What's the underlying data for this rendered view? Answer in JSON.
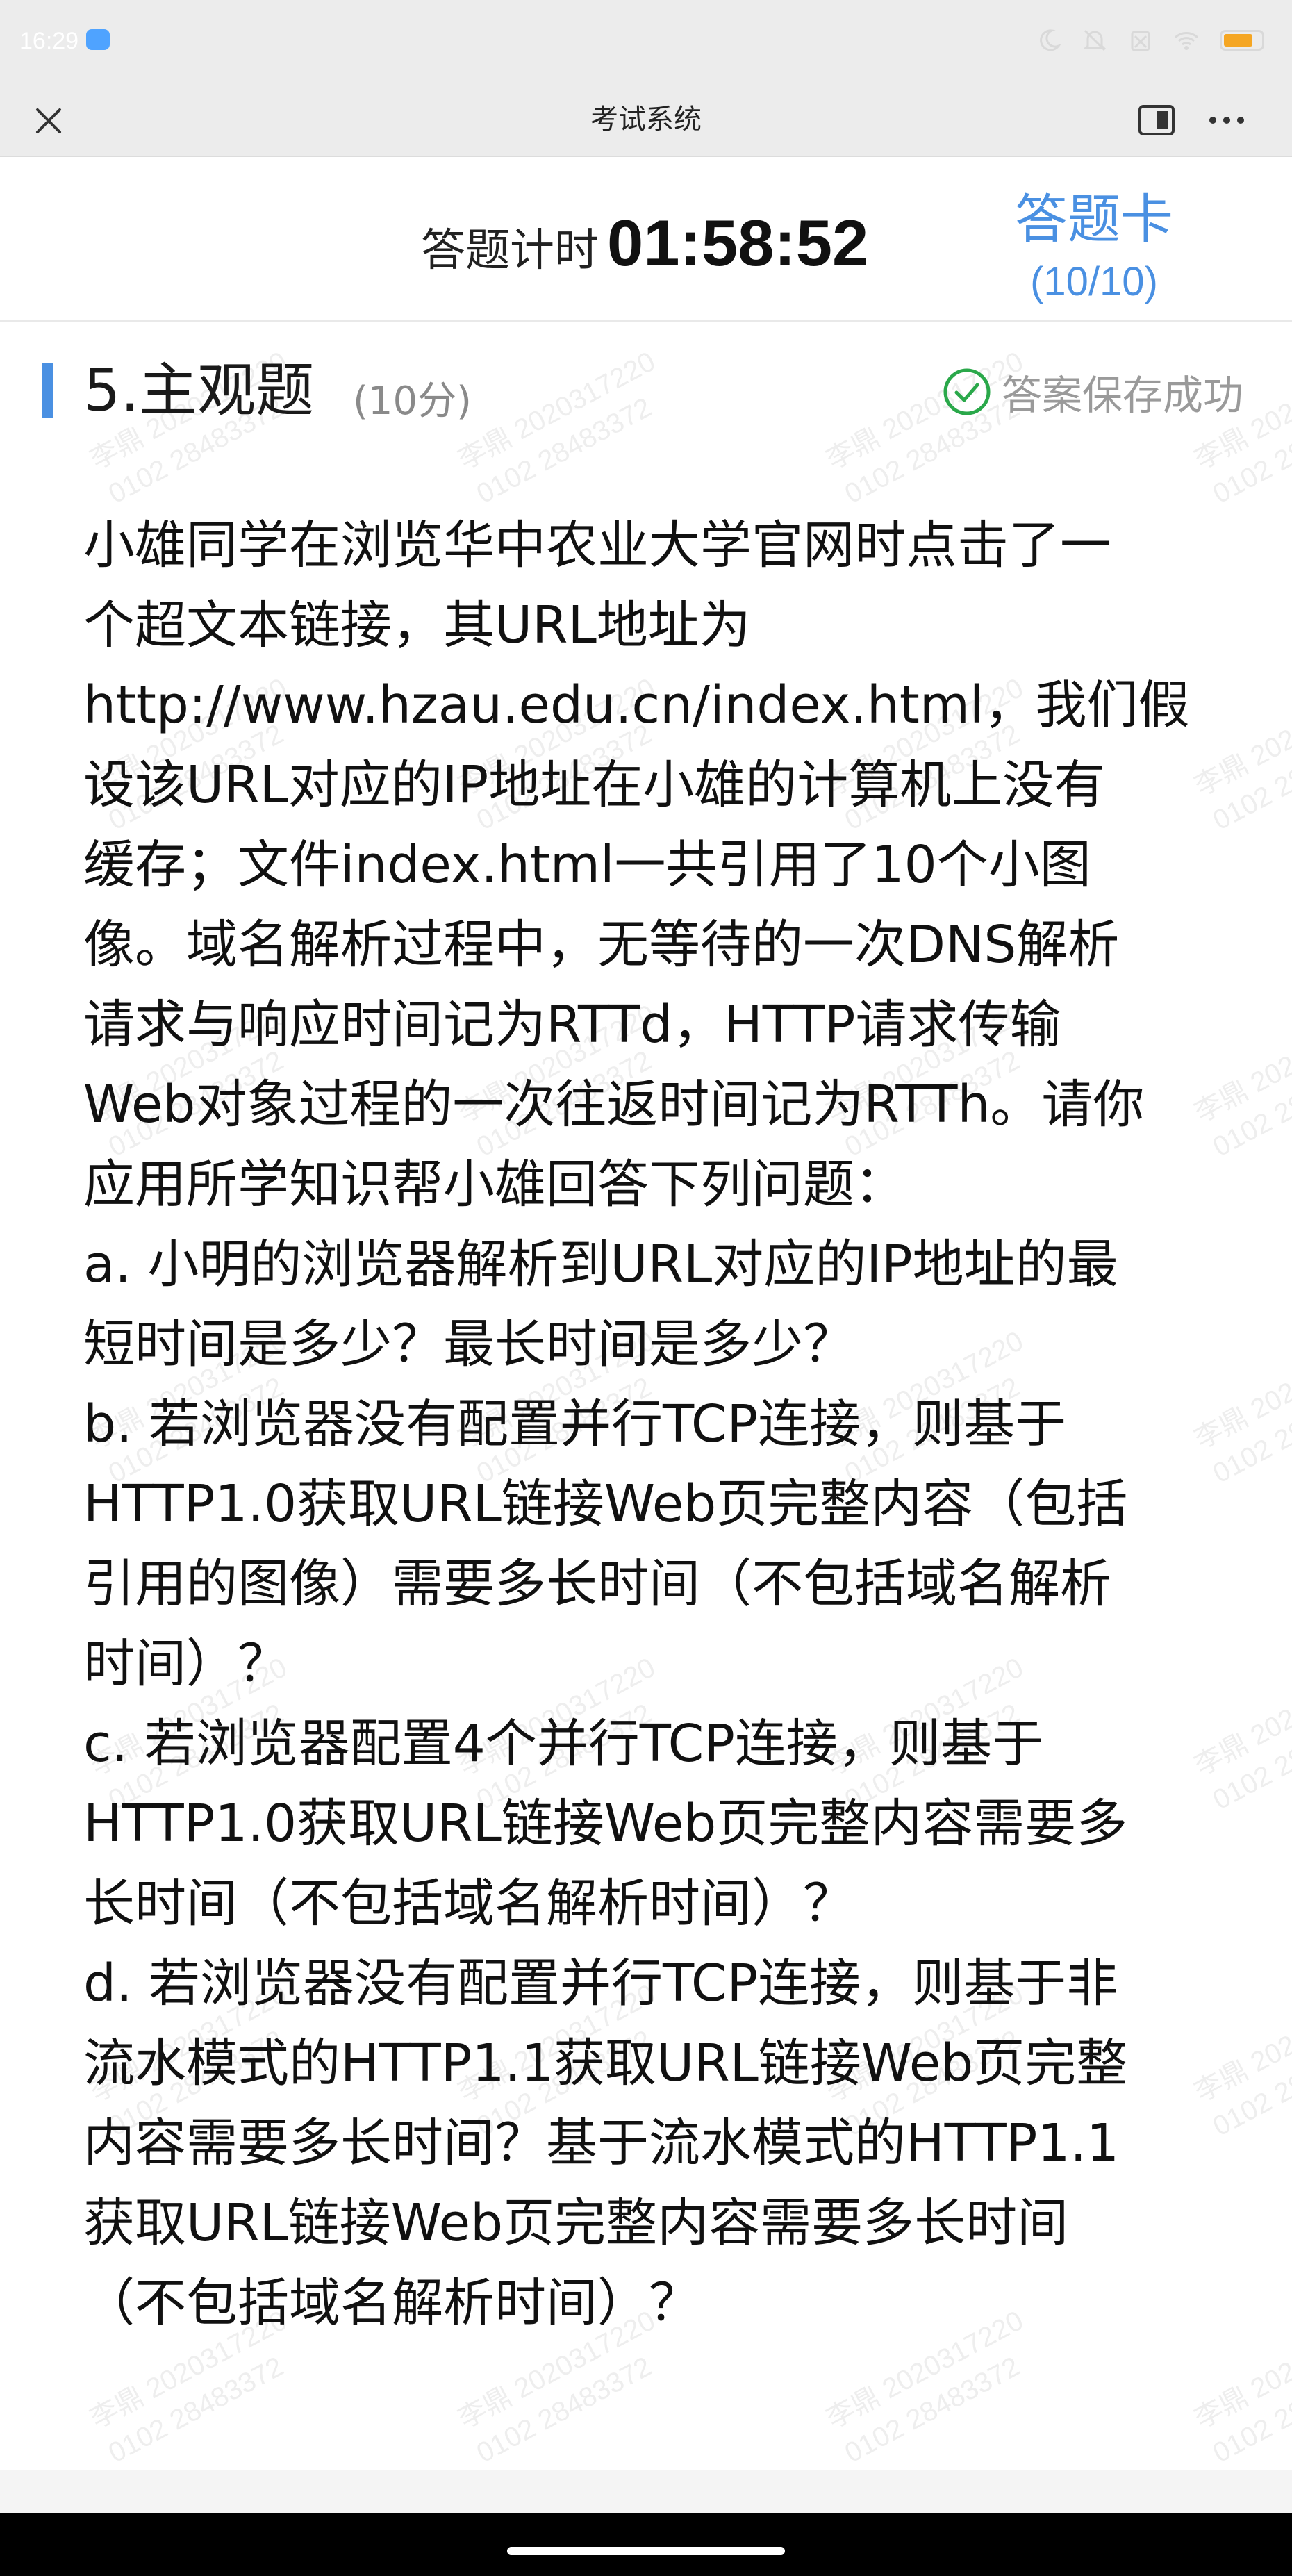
{
  "status_bar": {
    "time": "16:29",
    "icons": [
      "weather-icon",
      "moon-icon",
      "mute-icon",
      "no-sim-icon",
      "wifi-icon",
      "battery-icon"
    ],
    "battery_color": "#f5a623"
  },
  "title_bar": {
    "title": "考试系统"
  },
  "header": {
    "timer_label": "答题计时",
    "timer_value": "01:58:52",
    "answer_card_label": "答题卡",
    "answer_card_count": "(10/10)",
    "accent_color": "#4a90e2"
  },
  "question": {
    "title": "5.主观题",
    "points": "(10分)",
    "save_status": "答案保存成功",
    "save_status_color": "#2aa84a",
    "lines": [
      "小雄同学在浏览华中农业大学官网时点击了一",
      "个超文本链接，其URL地址为",
      "http://www.hzau.edu.cn/index.html，我们假",
      "设该URL对应的IP地址在小雄的计算机上没有",
      "缓存；文件index.html一共引用了10个小图",
      "像。域名解析过程中，无等待的一次DNS解析",
      "请求与响应时间记为RTTd，HTTP请求传输",
      "Web对象过程的一次往返时间记为RTTh。请你",
      "应用所学知识帮小雄回答下列问题：",
      "a. 小明的浏览器解析到URL对应的IP地址的最",
      "短时间是多少？最长时间是多少？",
      "b. 若浏览器没有配置并行TCP连接，则基于",
      "HTTP1.0获取URL链接Web页完整内容（包括",
      "引用的图像）需要多长时间（不包括域名解析",
      "时间）？",
      "c. 若浏览器配置4个并行TCP连接，则基于",
      "HTTP1.0获取URL链接Web页完整内容需要多",
      "长时间（不包括域名解析时间）？",
      "d. 若浏览器没有配置并行TCP连接，则基于非",
      "流水模式的HTTP1.1获取URL链接Web页完整",
      "内容需要多长时间？基于流水模式的HTTP1.1",
      "获取URL链接Web页完整内容需要多长时间",
      "（不包括域名解析时间）？"
    ]
  },
  "watermark": {
    "lines": [
      "李鼎 2020317220",
      "0102 28483372"
    ]
  }
}
